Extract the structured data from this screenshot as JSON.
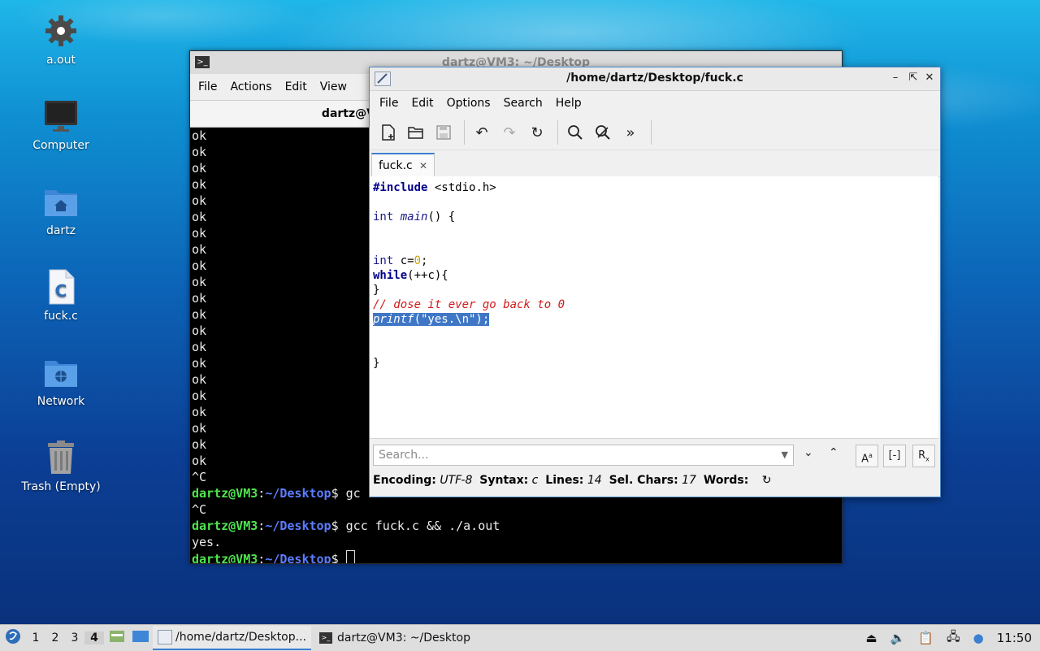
{
  "desktop": {
    "icons": [
      {
        "label": "a.out"
      },
      {
        "label": "Computer"
      },
      {
        "label": "dartz"
      },
      {
        "label": "fuck.c"
      },
      {
        "label": "Network"
      },
      {
        "label": "Trash (Empty)"
      }
    ]
  },
  "terminal": {
    "title": "dartz@VM3: ~/Desktop",
    "menu": [
      "File",
      "Actions",
      "Edit",
      "View"
    ],
    "tab_label": "dartz@VM3: ~/Desktop",
    "ok_lines": [
      "ok",
      "ok",
      "ok",
      "ok",
      "ok",
      "ok",
      "ok",
      "ok",
      "ok",
      "ok",
      "ok",
      "ok",
      "ok",
      "ok",
      "ok",
      "ok",
      "ok",
      "ok",
      "ok",
      "ok",
      "ok"
    ],
    "ctrl_c": "^C",
    "prompt_user": "dartz@VM3",
    "prompt_sep": ":",
    "prompt_path": "~/Desktop",
    "prompt_end": "$ ",
    "partial_cmd": "gc",
    "ctrl_c2": "^C",
    "cmd": "gcc fuck.c && ./a.out",
    "output": "yes."
  },
  "editor": {
    "title": "/home/dartz/Desktop/fuck.c",
    "menu": [
      "File",
      "Edit",
      "Options",
      "Search",
      "Help"
    ],
    "tab_label": "fuck.c",
    "code": {
      "l1_kw": "#include",
      "l1_rest": " <stdio.h>",
      "l2_type": "int",
      "l2_fn": "main",
      "l2_rest": "() {",
      "l3_type": "int",
      "l3_var": " c=",
      "l3_num": "0",
      "l3_end": ";",
      "l4_kw": "while",
      "l4_rest": "(++c){",
      "l5": "}",
      "l6_comment": "// dose it ever go back to 0",
      "l7_fn": "printf",
      "l7_rest": "(\"yes.\\n\");",
      "l8": "}"
    },
    "search_placeholder": "Search...",
    "status": {
      "encoding_label": "Encoding:",
      "encoding": "UTF-8",
      "syntax_label": "Syntax:",
      "syntax": "c",
      "lines_label": "Lines:",
      "lines": "14",
      "sel_label": "Sel. Chars:",
      "sel": "17",
      "words_label": "Words:"
    }
  },
  "taskbar": {
    "workspaces": [
      "1",
      "2",
      "3",
      "4"
    ],
    "tasks": [
      "/home/dartz/Desktop...",
      "dartz@VM3: ~/Desktop"
    ],
    "clock": "11:50"
  }
}
